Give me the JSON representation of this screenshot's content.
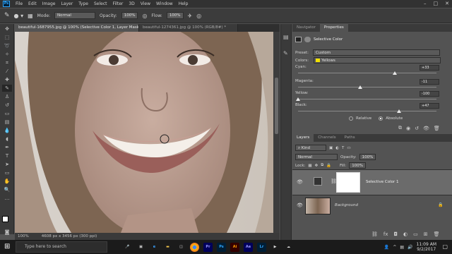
{
  "app": {
    "logo": "Ps"
  },
  "menu": [
    "File",
    "Edit",
    "Image",
    "Layer",
    "Type",
    "Select",
    "Filter",
    "3D",
    "View",
    "Window",
    "Help"
  ],
  "options": {
    "mode_label": "Mode:",
    "mode_value": "Normal",
    "opacity_label": "Opacity:",
    "opacity_value": "100%",
    "flow_label": "Flow:",
    "flow_value": "100%"
  },
  "tabs": [
    {
      "label": "beautiful-1687955.jpg @ 100% (Selective Color 1, Layer Mask/8) *"
    },
    {
      "label": "beautiful-1274361.jpg @ 100% (RGB/8#) *"
    }
  ],
  "status": {
    "zoom": "100%",
    "doc": "4608 px x 3456 px (300 ppi)"
  },
  "panel_tabs": [
    "Navigator",
    "Properties"
  ],
  "properties": {
    "title": "Selective Color",
    "preset_label": "Preset:",
    "preset_value": "Custom",
    "colors_label": "Colors:",
    "colors_value": "Yellows",
    "sliders": [
      {
        "label": "Cyan:",
        "value": "+33",
        "pos": 0.7
      },
      {
        "label": "Magenta:",
        "value": "-11",
        "pos": 0.45
      },
      {
        "label": "Yellow:",
        "value": "-100",
        "pos": 0.0
      },
      {
        "label": "Black:",
        "value": "+47",
        "pos": 0.73
      }
    ],
    "relative": "Relative",
    "absolute": "Absolute"
  },
  "layers_tabs": [
    "Layers",
    "Channels",
    "Paths"
  ],
  "layers": {
    "kind_label": "Kind",
    "blend": "Normal",
    "opacity_label": "Opacity:",
    "opacity_value": "100%",
    "lock_label": "Lock:",
    "fill_label": "Fill:",
    "fill_value": "100%",
    "items": [
      {
        "name": "Selective Color 1"
      },
      {
        "name": "Background"
      }
    ]
  },
  "taskbar": {
    "search_placeholder": "Type here to search",
    "time": "11:09 AM",
    "date": "9/2/2017",
    "apps": [
      {
        "icon": "Pr",
        "color": "#9999ff",
        "bg": "#00005b"
      },
      {
        "icon": "Ps",
        "color": "#31a8ff",
        "bg": "#001e36"
      },
      {
        "icon": "Ai",
        "color": "#ff9a00",
        "bg": "#330000"
      },
      {
        "icon": "Ae",
        "color": "#9999ff",
        "bg": "#00005b"
      },
      {
        "icon": "Lr",
        "color": "#31a8ff",
        "bg": "#001e36"
      }
    ]
  },
  "colors": {
    "accent": "#31a8ff",
    "yellow_swatch": "#f2e200"
  }
}
